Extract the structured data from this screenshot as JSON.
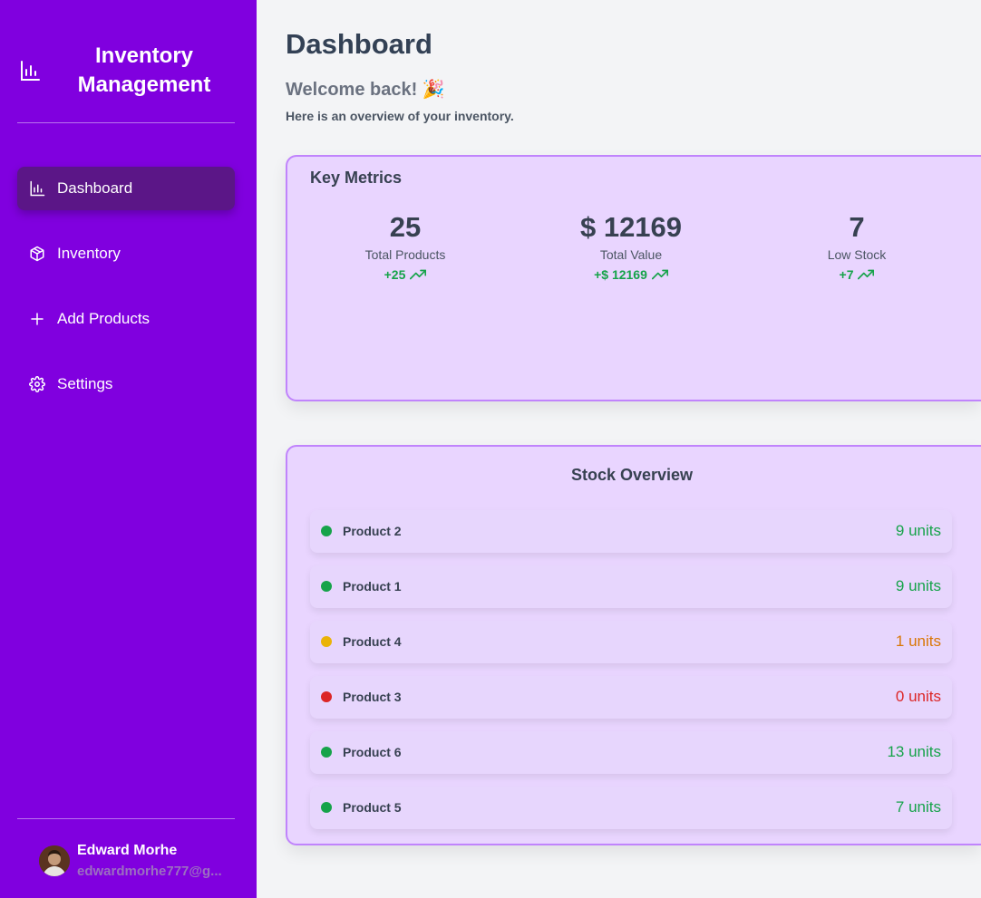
{
  "sidebar": {
    "title": "Inventory Management",
    "items": [
      {
        "label": "Dashboard",
        "icon": "chart-icon",
        "active": true
      },
      {
        "label": "Inventory",
        "icon": "box-icon",
        "active": false
      },
      {
        "label": "Add Products",
        "icon": "plus-icon",
        "active": false
      },
      {
        "label": "Settings",
        "icon": "gear-icon",
        "active": false
      }
    ],
    "user": {
      "name": "Edward Morhe",
      "email": "edwardmorhe777@g..."
    }
  },
  "main": {
    "title": "Dashboard",
    "welcome": "Welcome back! 🎉",
    "subtitle": "Here is an overview of your inventory.",
    "metrics_heading": "Key Metrics",
    "metrics": [
      {
        "value": "25",
        "label": "Total Products",
        "change": "+25"
      },
      {
        "value": "$ 12169",
        "label": "Total Value",
        "change": "+$ 12169"
      },
      {
        "value": "7",
        "label": "Low Stock",
        "change": "+7"
      }
    ],
    "stock_heading": "Stock Overview",
    "stock": [
      {
        "name": "Product 2",
        "units": "9 units",
        "status": "ok"
      },
      {
        "name": "Product 1",
        "units": "9 units",
        "status": "ok"
      },
      {
        "name": "Product 4",
        "units": "1 units",
        "status": "low"
      },
      {
        "name": "Product 3",
        "units": "0 units",
        "status": "out"
      },
      {
        "name": "Product 6",
        "units": "13 units",
        "status": "ok"
      },
      {
        "name": "Product 5",
        "units": "7 units",
        "status": "ok"
      }
    ]
  },
  "colors": {
    "sidebar_bg": "#8000df",
    "active_bg": "#5b1687",
    "ok": "#16a34a",
    "low": "#eab308",
    "low_text": "#d97706",
    "out": "#dc2626"
  }
}
